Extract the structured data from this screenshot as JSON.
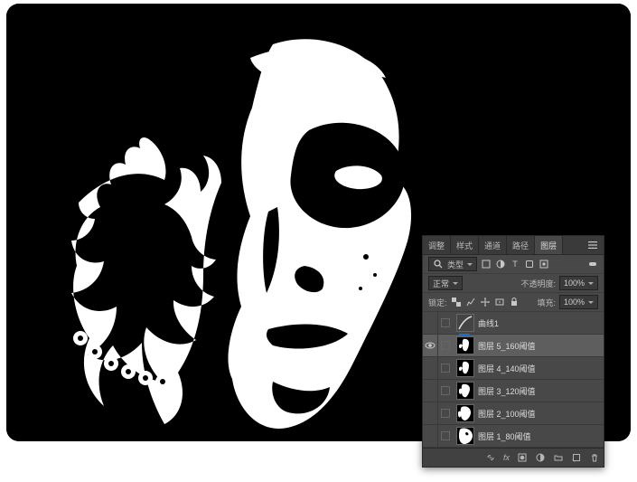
{
  "tabs": [
    {
      "label": "调整",
      "active": false
    },
    {
      "label": "样式",
      "active": false
    },
    {
      "label": "通道",
      "active": false
    },
    {
      "label": "路径",
      "active": false
    },
    {
      "label": "图层",
      "active": true
    }
  ],
  "filter": {
    "search_icon": "search-icon",
    "kind_label": "类型",
    "blend_mode": "正常",
    "lock_label": "锁定:",
    "opacity_label": "不透明度:",
    "opacity_value": "100%",
    "fill_label": "填充:",
    "fill_value": "100%"
  },
  "layers": [
    {
      "visible": false,
      "name": "曲线1",
      "thumb": "curves",
      "selected": false
    },
    {
      "visible": true,
      "name": "图层 5_160阈值",
      "thumb": "face",
      "selected": true
    },
    {
      "visible": false,
      "name": "图层 4_140阈值",
      "thumb": "face",
      "selected": false
    },
    {
      "visible": false,
      "name": "图层 3_120阈值",
      "thumb": "face",
      "selected": false
    },
    {
      "visible": false,
      "name": "图层 2_100阈值",
      "thumb": "face",
      "selected": false
    },
    {
      "visible": false,
      "name": "图层 1_80阈值",
      "thumb": "face",
      "selected": false
    }
  ],
  "footer_icons": [
    "link-icon",
    "fx-icon",
    "mask-icon",
    "adjust-icon",
    "group-icon",
    "new-icon",
    "trash-icon"
  ]
}
